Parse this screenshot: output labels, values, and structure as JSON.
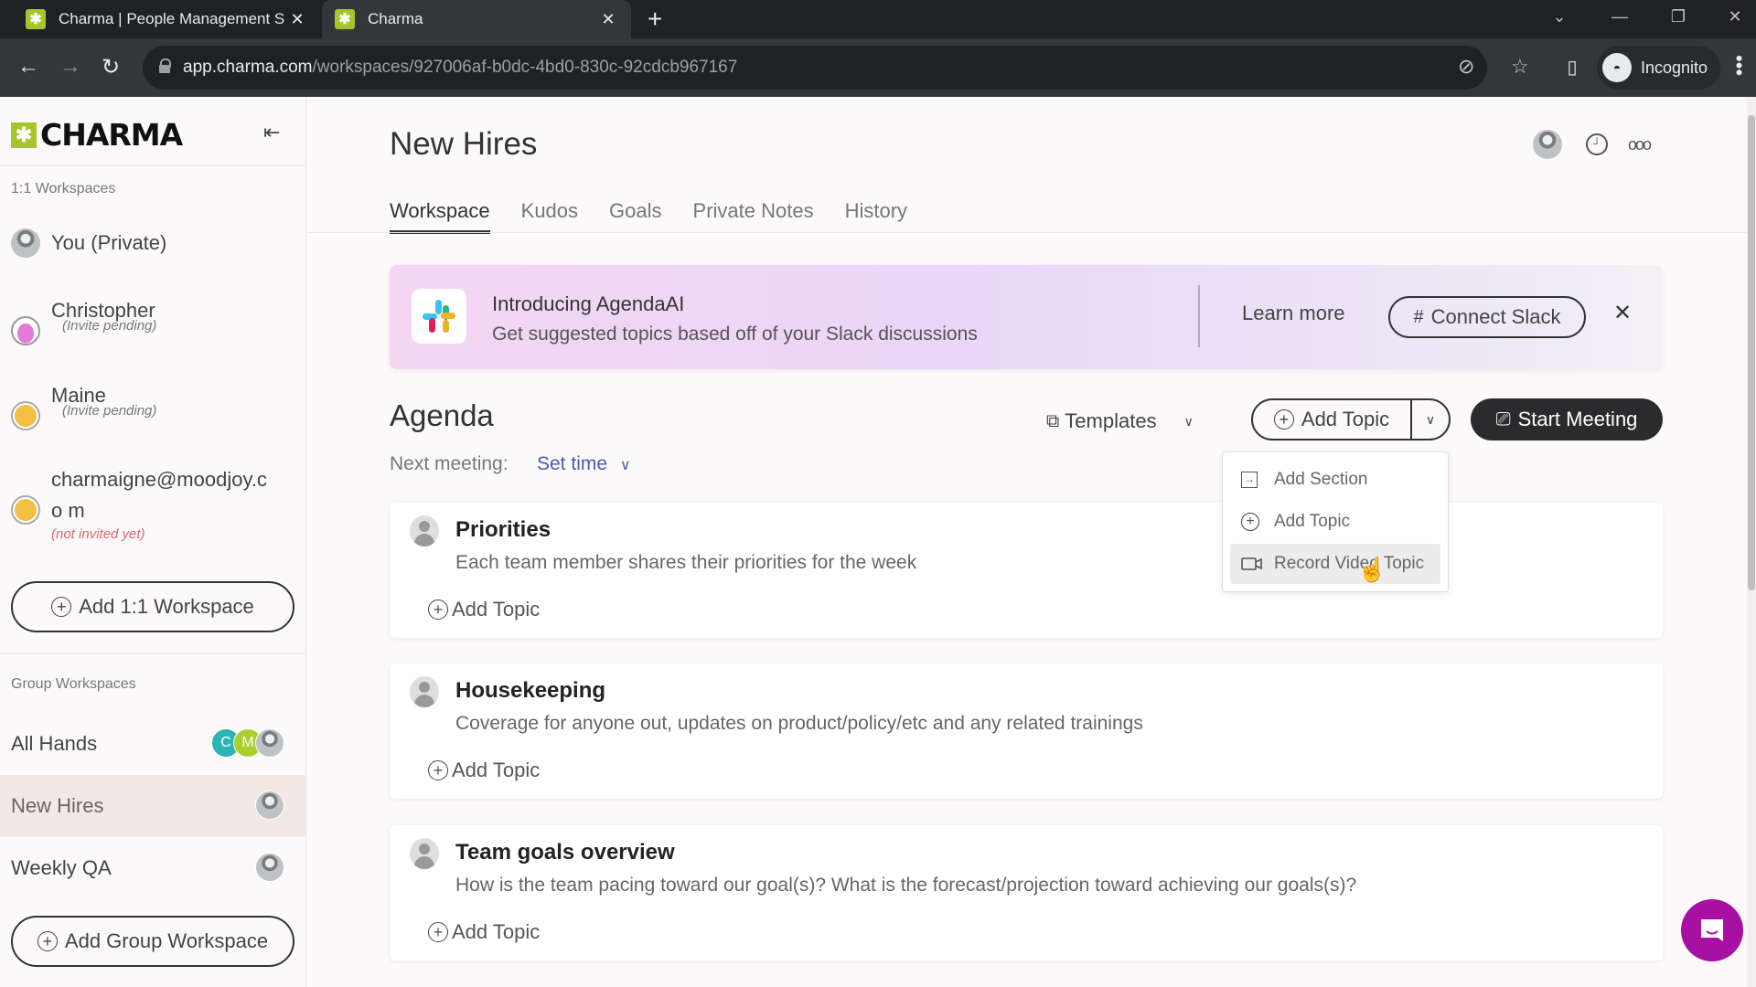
{
  "browser": {
    "tabs": [
      {
        "title": "Charma | People Management S",
        "favicon": "charma-favicon"
      },
      {
        "title": "Charma",
        "favicon": "charma-favicon",
        "active": true
      }
    ],
    "url_host": "app.charma.com",
    "url_path": "/workspaces/927006af-b0dc-4bd0-830c-92cdcb967167",
    "profile_label": "Incognito"
  },
  "sidebar": {
    "logo_text": "CHARMA",
    "one_on_one_label": "1:1 Workspaces",
    "one_on_one": [
      {
        "name": "You (Private)",
        "status": "",
        "avatar": "photo"
      },
      {
        "name": "Christopher",
        "status": "(Invite pending)",
        "avatar": "pink"
      },
      {
        "name": "Maine",
        "status": "(Invite pending)",
        "avatar": "yellow"
      },
      {
        "name": "charmaigne@moodjoy.co m",
        "status": "(not invited yet)",
        "avatar": "yellow"
      }
    ],
    "add_one_on_one": "Add 1:1 Workspace",
    "group_label": "Group Workspaces",
    "groups": [
      {
        "name": "All Hands",
        "members": [
          "C",
          "M",
          "photo"
        ]
      },
      {
        "name": "New Hires",
        "members": [
          "photo"
        ],
        "active": true
      },
      {
        "name": "Weekly QA",
        "members": [
          "photo"
        ]
      }
    ],
    "add_group": "Add Group Workspace"
  },
  "header": {
    "title": "New Hires",
    "tabs": [
      "Workspace",
      "Kudos",
      "Goals",
      "Private Notes",
      "History"
    ],
    "active_tab": "Workspace"
  },
  "banner": {
    "title": "Introducing AgendaAI",
    "subtitle": "Get suggested topics based off of your Slack discussions",
    "learn_more": "Learn more",
    "connect": "Connect Slack"
  },
  "agenda": {
    "title": "Agenda",
    "next_meeting_label": "Next meeting:",
    "set_time": "Set time",
    "templates": "Templates",
    "add_topic": "Add Topic",
    "start_meeting": "Start Meeting",
    "dropdown": [
      "Add Section",
      "Add Topic",
      "Record Video Topic"
    ],
    "dropdown_hovered": "Record Video Topic",
    "sections": [
      {
        "title": "Priorities",
        "description": "Each team member shares their priorities for the week",
        "add_label": "Add Topic"
      },
      {
        "title": "Housekeeping",
        "description": "Coverage for anyone out, updates on product/policy/etc and any related trainings",
        "add_label": "Add Topic"
      },
      {
        "title": "Team goals overview",
        "description": "How is the team pacing toward our goal(s)? What is the forecast/projection toward achieving our goals(s)?",
        "add_label": "Add Topic"
      }
    ]
  },
  "colors": {
    "brand_green": "#a7c52b",
    "chat_purple": "#a80fa3",
    "link_blue": "#4b5bb0",
    "dark_button": "#2b2a2c"
  }
}
